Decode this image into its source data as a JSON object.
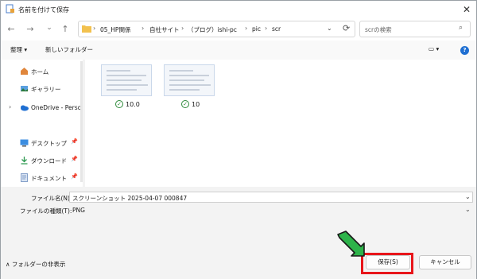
{
  "window": {
    "title": "名前を付けて保存",
    "close_glyph": "✕"
  },
  "nav": {
    "back_glyph": "←",
    "forward_glyph": "→",
    "recent_glyph": "⌄",
    "up_glyph": "↑",
    "breadcrumb": [
      "05_HP関係",
      "自社サイト",
      "（ブログ）ishi-pc",
      "pic",
      "scr"
    ],
    "separator": "›",
    "dropdown_glyph": "⌄",
    "refresh_glyph": "⟳",
    "search_placeholder": "scrの検索",
    "search_glyph": "⌕"
  },
  "commands": {
    "organize": "整理 ▾",
    "new_folder": "新しいフォルダー",
    "view_glyph": "▭ ▾",
    "help_glyph": "?"
  },
  "sidebar": {
    "items": [
      {
        "label": "ホーム",
        "icon": "home-icon",
        "pin": false
      },
      {
        "label": "ギャラリー",
        "icon": "gallery-icon",
        "pin": false
      },
      {
        "label": "OneDrive - Perso",
        "icon": "onedrive-icon",
        "pin": false
      },
      {
        "label": "デスクトップ",
        "icon": "desktop-icon",
        "pin": true
      },
      {
        "label": "ダウンロード",
        "icon": "download-icon",
        "pin": true
      },
      {
        "label": "ドキュメント",
        "icon": "documents-icon",
        "pin": true
      }
    ],
    "expand_glyph": "›",
    "pin_glyph": "📌"
  },
  "files": [
    {
      "name": "10.0",
      "synced_glyph": "✓"
    },
    {
      "name": "10",
      "synced_glyph": "✓"
    }
  ],
  "form": {
    "filename_label": "ファイル名(N):",
    "filename_value": "スクリーンショット 2025-04-07 000847",
    "filetype_label": "ファイルの種類(T):",
    "filetype_value": "PNG",
    "dropdown_glyph": "⌄"
  },
  "footer": {
    "toggle_label": "∧ フォルダーの非表示",
    "save_label": "保存(S)",
    "cancel_label": "キャンセル"
  },
  "colors": {
    "highlight": "#e8151a",
    "arrow": "#2db34a",
    "accent": "#1f6fd2"
  }
}
